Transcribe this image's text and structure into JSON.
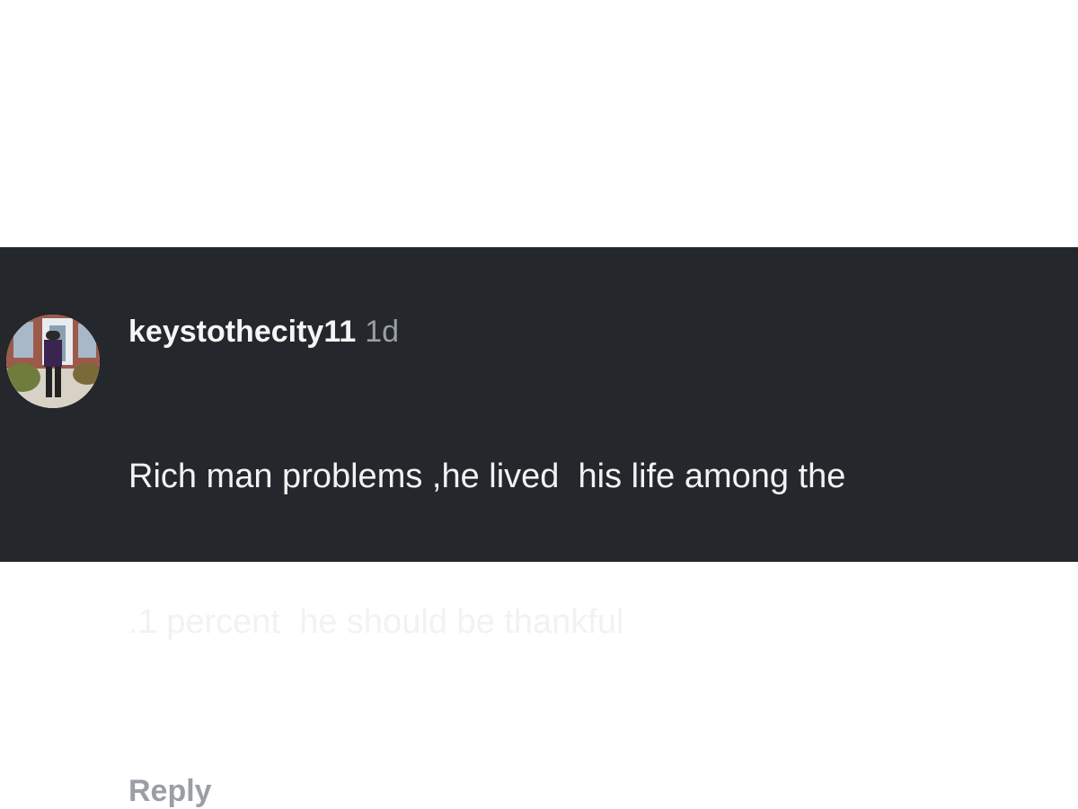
{
  "comment": {
    "username": "keystothecity11",
    "timestamp": "1d",
    "text_line1": "Rich man problems ,he lived  his life among the",
    "text_line2": ".1 percent  he should be thankful",
    "reply_label": "Reply"
  },
  "colors": {
    "panel_background": "#24272b",
    "page_background": "#ffffff",
    "text_primary": "#f2f2f2",
    "text_secondary": "#9a9ea5"
  }
}
